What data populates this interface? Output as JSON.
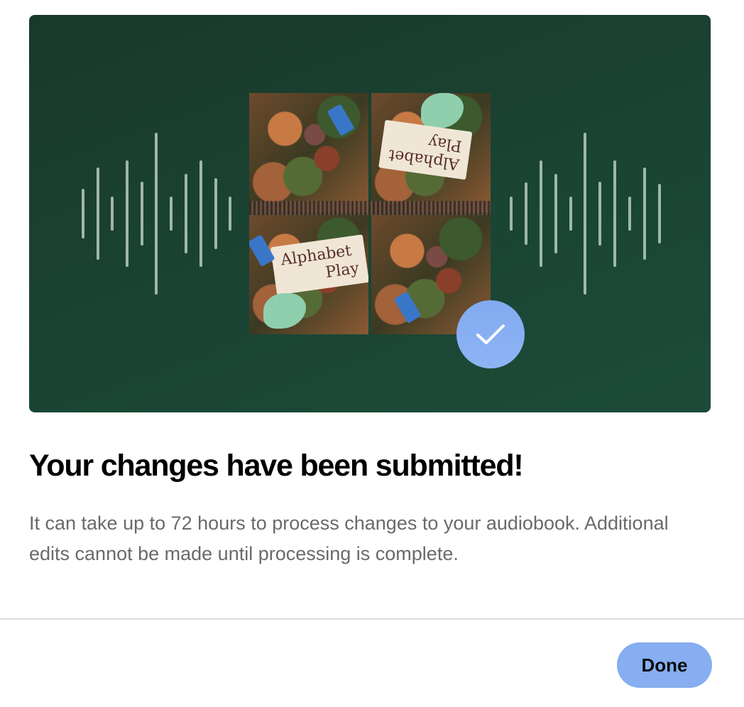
{
  "dialog": {
    "title": "Your changes have been submitted!",
    "description": "It can take up to 72 hours to process changes to your audiobook. Additional edits cannot be made until processing is complete.",
    "done_label": "Done"
  },
  "cover": {
    "sign_text_line1": "Alphabet",
    "sign_text_line2": "Play"
  },
  "icons": {
    "waveform": "audio-waveform-icon",
    "status": "checkmark-icon"
  },
  "colors": {
    "hero_background": "#1a4433",
    "waveform_bars": "#9fb7ab",
    "check_badge": "#86aef0",
    "done_button": "#86aef0",
    "title_text": "#000000",
    "description_text": "#6a6a6a"
  }
}
